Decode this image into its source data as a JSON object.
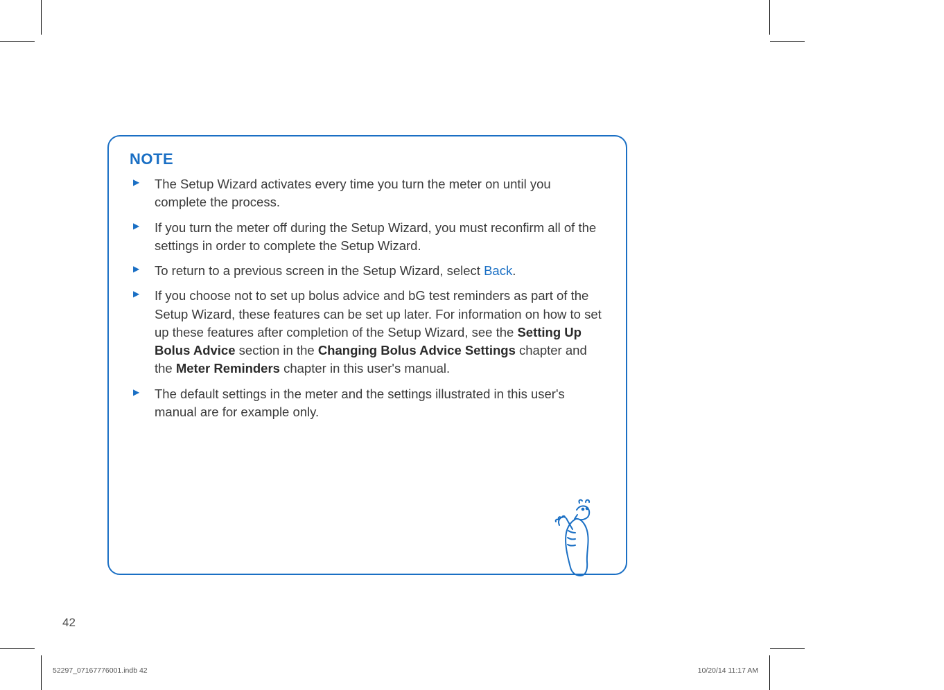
{
  "note": {
    "title": "NOTE",
    "items": [
      {
        "text": "The Setup Wizard activates every time you turn the meter on until you complete the process."
      },
      {
        "text": "If you turn the meter off during the Setup Wizard, you must reconfirm all of the settings in order to complete the Setup Wizard."
      },
      {
        "prefix": "To return to a previous screen in the Setup Wizard, select ",
        "link": "Back",
        "suffix": "."
      },
      {
        "p1": "If you choose not to set up bolus advice and bG test reminders as part of the Setup Wizard, these features can be set up later. For information on how to set up these features after completion of the Setup Wizard, see the ",
        "b1": "Setting Up Bolus Advice",
        "p2": " section in the ",
        "b2": "Changing Bolus Advice Settings",
        "p3": " chapter and the ",
        "b3": "Meter Reminders",
        "p4": " chapter in this user's manual."
      },
      {
        "text": "The default settings in the meter and the settings illustrated in this user's manual are for example only."
      }
    ]
  },
  "pageNumber": "42",
  "footer": {
    "left": "52297_07167776001.indb   42",
    "right": "10/20/14   11:17 AM"
  }
}
